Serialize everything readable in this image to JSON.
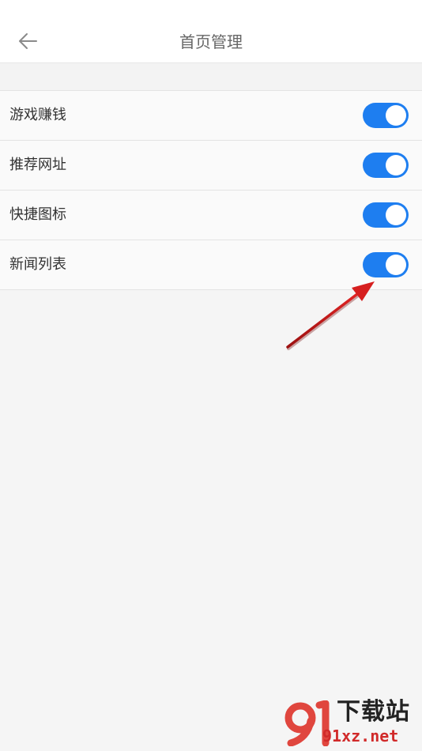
{
  "header": {
    "title": "首页管理",
    "back_icon": "arrow-left-icon"
  },
  "settings": [
    {
      "label": "游戏赚钱",
      "enabled": true
    },
    {
      "label": "推荐网址",
      "enabled": true
    },
    {
      "label": "快捷图标",
      "enabled": true
    },
    {
      "label": "新闻列表",
      "enabled": true
    }
  ],
  "colors": {
    "toggle_on": "#1e7ef0",
    "annotation_arrow": "#d61f1f"
  },
  "watermark": {
    "title": "下载站",
    "url": "91xz.net",
    "logo": "91-logo"
  }
}
